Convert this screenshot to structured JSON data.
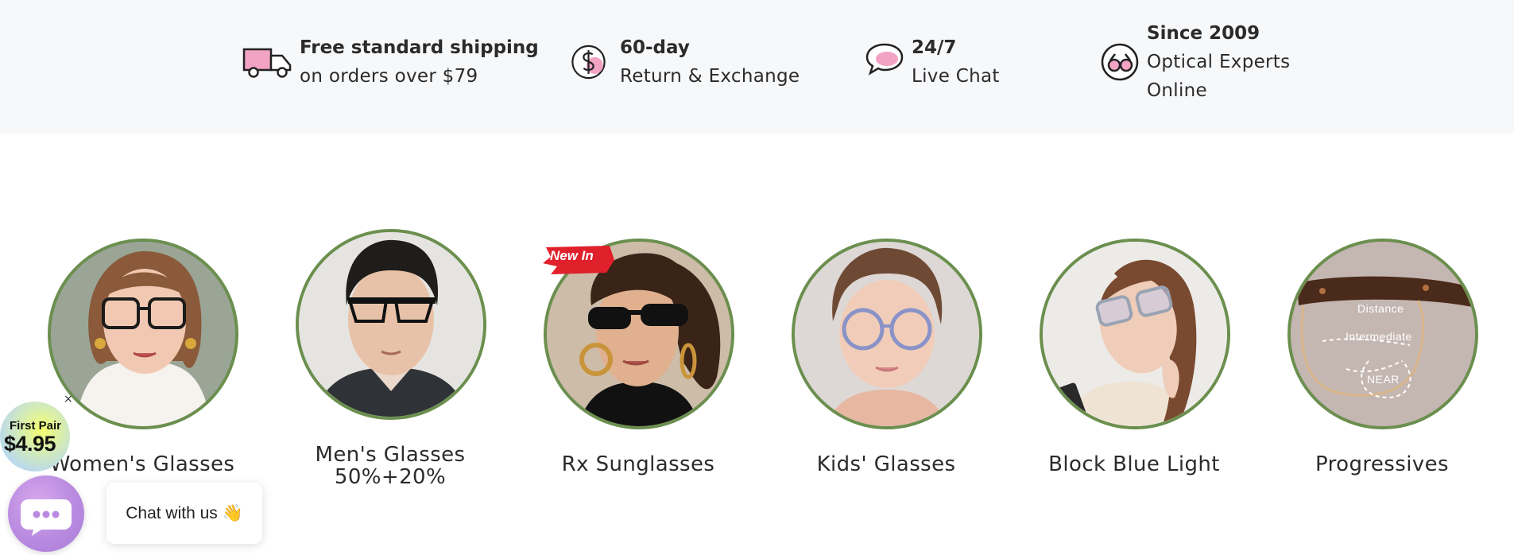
{
  "benefits": [
    {
      "icon": "truck-icon",
      "title": "Free standard shipping",
      "subtitle": "on orders over $79"
    },
    {
      "icon": "dollar-coin-icon",
      "title": "60-day",
      "subtitle": "Return & Exchange"
    },
    {
      "icon": "chat-bubble-icon",
      "title": "24/7",
      "subtitle": "Live Chat"
    },
    {
      "icon": "glasses-badge-icon",
      "title": "Since 2009",
      "subtitle": "Optical Experts Online"
    }
  ],
  "categories": [
    {
      "label": "Women's Glasses"
    },
    {
      "label": "Men's Glasses",
      "sublabel": "50%+20%"
    },
    {
      "label": "Rx Sunglasses",
      "badge": "New In"
    },
    {
      "label": "Kids' Glasses"
    },
    {
      "label": "Block Blue Light"
    },
    {
      "label": "Progressives",
      "overlay": [
        "Distance",
        "Intermediate",
        "NEAR"
      ]
    }
  ],
  "promo": {
    "line1": "First Pair",
    "line2": "$4.95",
    "close": "×"
  },
  "chat": {
    "label": "Chat with us 👋"
  },
  "colors": {
    "accent_pink": "#f2a3c4",
    "ring_green": "#6b8f4e",
    "chat_purple": "#b98ae0",
    "badge_red": "#e0202a"
  }
}
